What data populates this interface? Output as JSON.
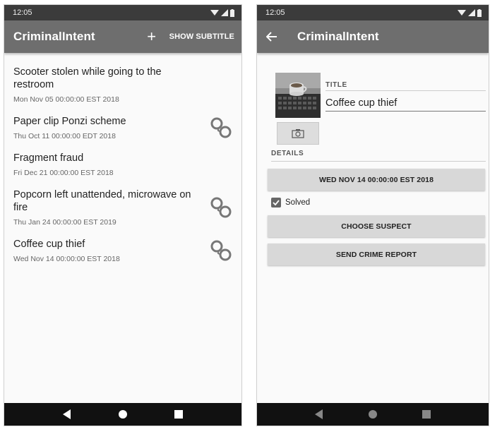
{
  "list_screen": {
    "status": {
      "time": "12:05"
    },
    "app_bar": {
      "title": "CriminalIntent",
      "add_label": "+",
      "subtitle_action": "SHOW SUBTITLE"
    },
    "crimes": [
      {
        "title": "Scooter stolen while going to the restroom",
        "date": "Mon Nov 05 00:00:00 EST 2018",
        "solved": false
      },
      {
        "title": "Paper clip Ponzi scheme",
        "date": "Thu Oct 11 00:00:00 EDT 2018",
        "solved": true
      },
      {
        "title": "Fragment fraud",
        "date": "Fri Dec 21 00:00:00 EST 2018",
        "solved": false
      },
      {
        "title": "Popcorn left unattended, microwave on fire",
        "date": "Thu Jan 24 00:00:00 EST 2019",
        "solved": true
      },
      {
        "title": "Coffee cup thief",
        "date": "Wed Nov 14 00:00:00 EST 2018",
        "solved": true
      }
    ]
  },
  "detail_screen": {
    "status": {
      "time": "12:05"
    },
    "app_bar": {
      "title": "CriminalIntent"
    },
    "title_label": "TITLE",
    "title_value": "Coffee cup thief",
    "details_label": "DETAILS",
    "date_button": "WED NOV 14 00:00:00 EST 2018",
    "solved_label": "Solved",
    "solved_checked": true,
    "suspect_button": "CHOOSE SUSPECT",
    "report_button": "SEND CRIME REPORT"
  },
  "colors": {
    "status_bar": "#3b3b3b",
    "app_bar": "#6e6e6e",
    "nav_bar": "#111111",
    "button": "#d8d8d8"
  },
  "icons": [
    "wifi-icon",
    "signal-icon",
    "battery-icon",
    "handcuffs-icon",
    "camera-icon",
    "back-arrow-icon",
    "nav-back-icon",
    "nav-home-icon",
    "nav-recents-icon"
  ]
}
